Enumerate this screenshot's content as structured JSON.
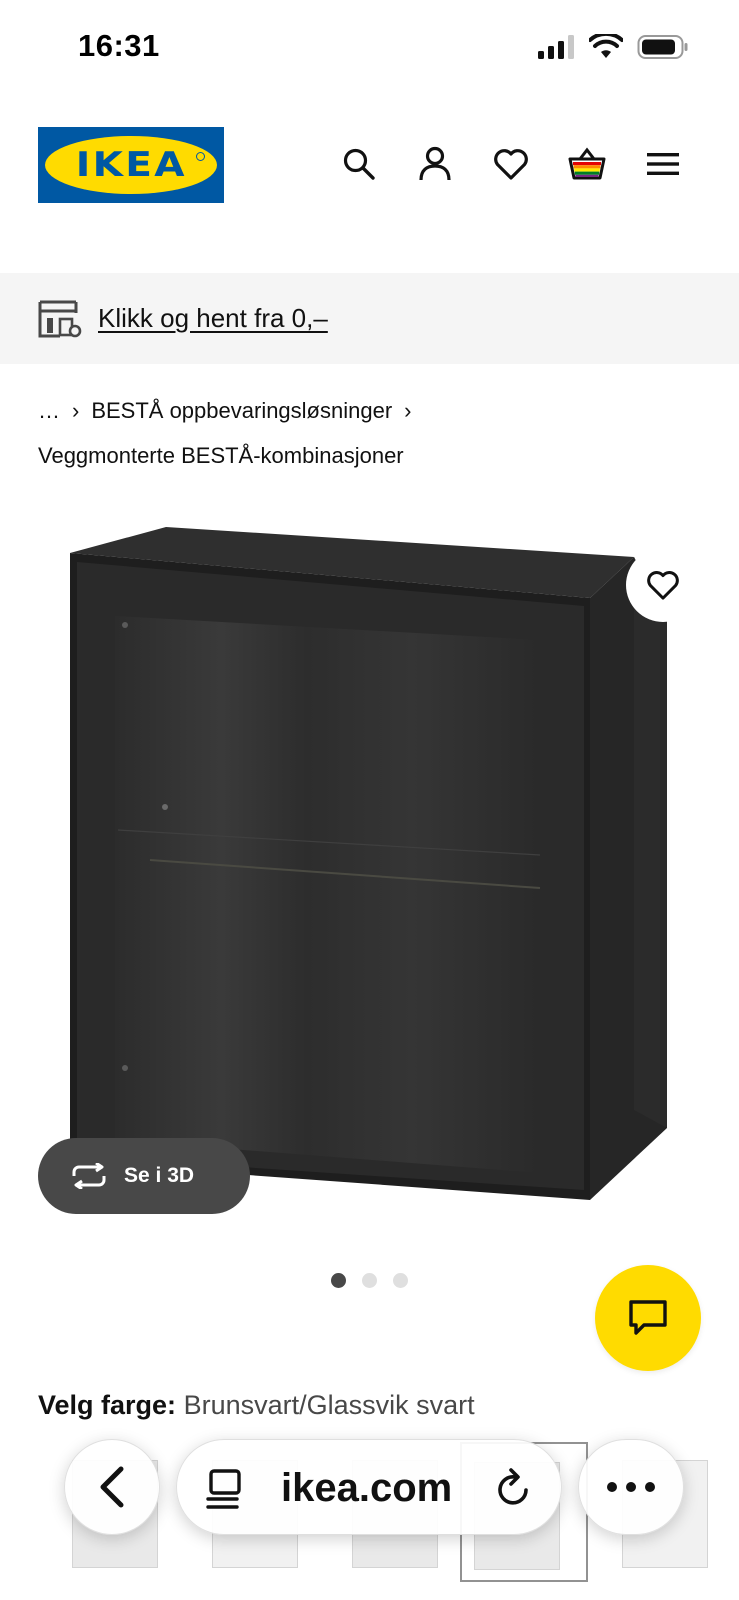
{
  "status_bar": {
    "time": "16:31",
    "icons": [
      "cellular-signal-icon",
      "wifi-icon",
      "battery-icon"
    ]
  },
  "header": {
    "logo_text": "IKEA",
    "icons": [
      "search-icon",
      "account-icon",
      "heart-icon",
      "shopping-basket-icon",
      "hamburger-menu-icon"
    ]
  },
  "promo": {
    "icon": "store-icon",
    "link_label": "Klikk og hent fra 0,–"
  },
  "breadcrumb": {
    "ellipsis": "…",
    "separator": "›",
    "items": [
      "BESTÅ oppbevaringsløsninger",
      "Veggmonterte BESTÅ-kombinasjoner"
    ]
  },
  "product": {
    "image": "BESTÅ wall cabinet with glass door, black-brown",
    "favourite_icon": "heart-icon",
    "view_3d_label": "Se i 3D",
    "view_3d_icon": "rotate-3d-icon",
    "carousel": {
      "total": 3,
      "active": 1
    }
  },
  "chat": {
    "icon": "chat-bubble-icon",
    "color": "#ffdb00"
  },
  "color_select": {
    "label": "Velg farge:",
    "value": "Brunsvart/Glassvik svart",
    "thumbnail_count": 5,
    "selected_index": 3
  },
  "browser": {
    "url": "ikea.com",
    "back_icon": "chevron-left-icon",
    "reader_icon": "reader-mode-icon",
    "reload_icon": "reload-icon",
    "more_icon": "more-dots-icon"
  },
  "colors": {
    "ikea_blue": "#0058a3",
    "ikea_yellow": "#ffdb00",
    "dark_grey": "#484848",
    "promo_bg": "#f5f5f5"
  }
}
